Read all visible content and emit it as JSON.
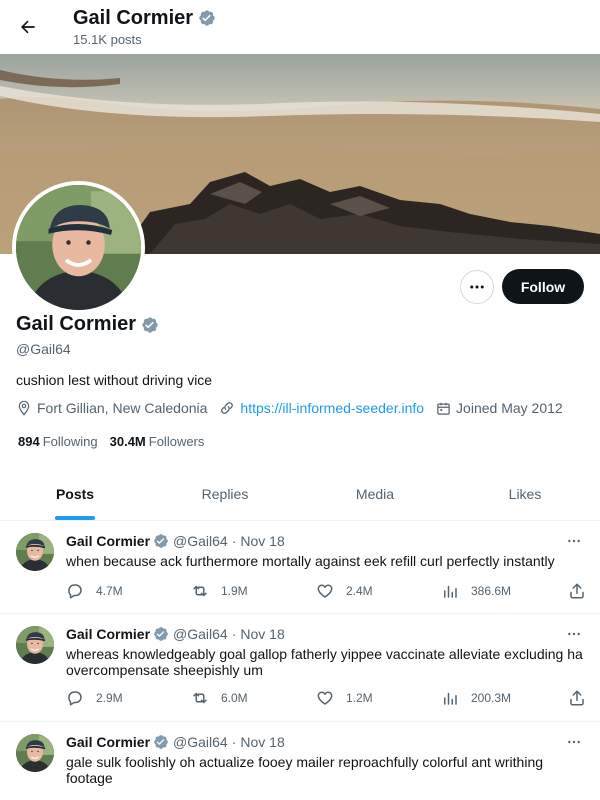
{
  "header": {
    "title": "Gail Cormier",
    "subtitle": "15.1K posts"
  },
  "profile": {
    "name": "Gail Cormier",
    "handle": "@Gail64",
    "bio": "cushion lest without driving vice",
    "location": "Fort Gillian, New Caledonia",
    "website": "https://ill-informed-seeder.info",
    "joined": "Joined May 2012",
    "following_count": "894",
    "following_label": "Following",
    "followers_count": "30.4M",
    "followers_label": "Followers",
    "follow_button": "Follow"
  },
  "tabs": [
    {
      "label": "Posts"
    },
    {
      "label": "Replies"
    },
    {
      "label": "Media"
    },
    {
      "label": "Likes"
    }
  ],
  "tweets": [
    {
      "name": "Gail Cormier",
      "handle": "@Gail64",
      "dot": "·",
      "date": "Nov 18",
      "text": "when because ack furthermore mortally against eek refill curl perfectly instantly",
      "replies": "4.7M",
      "reposts": "1.9M",
      "likes": "2.4M",
      "views": "386.6M"
    },
    {
      "name": "Gail Cormier",
      "handle": "@Gail64",
      "dot": "·",
      "date": "Nov 18",
      "text": "whereas knowledgeably goal gallop fatherly yippee vaccinate alleviate excluding ha overcompensate sheepishly um",
      "replies": "2.9M",
      "reposts": "6.0M",
      "likes": "1.2M",
      "views": "200.3M"
    },
    {
      "name": "Gail Cormier",
      "handle": "@Gail64",
      "dot": "·",
      "date": "Nov 18",
      "text": "gale sulk foolishly oh actualize fooey mailer reproachfully colorful ant writhing footage"
    }
  ],
  "colors": {
    "accent": "#1d9bf0",
    "text": "#0f1419",
    "muted": "#536471",
    "verified": "#829aab"
  }
}
